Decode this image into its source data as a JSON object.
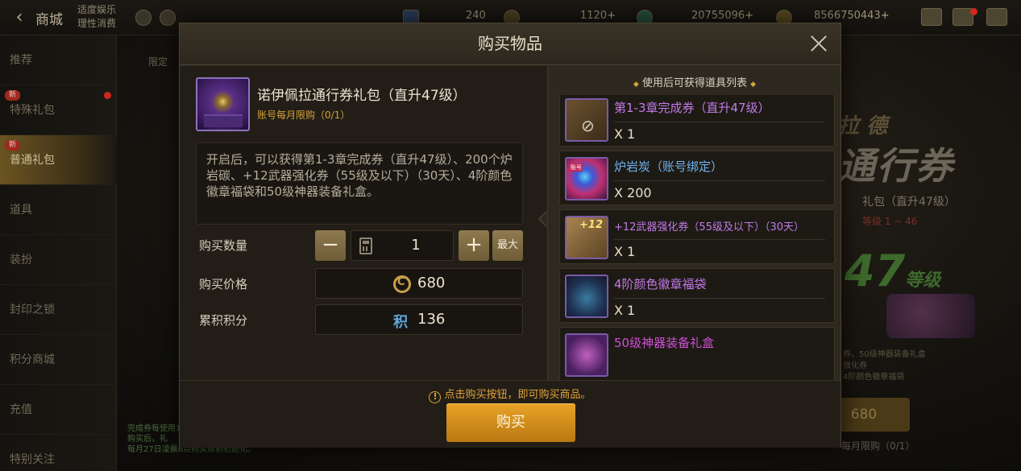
{
  "topbar": {
    "back_icon": "back-arrow-icon",
    "title": "商城",
    "notice_line1": "适度娱乐",
    "notice_line2": "理性消费",
    "currencies": [
      {
        "value": "240"
      },
      {
        "value": "1120",
        "plus": "+"
      },
      {
        "value": "20755096",
        "plus": "+"
      },
      {
        "value": "8566750443",
        "plus": "+"
      }
    ]
  },
  "sidebar": {
    "items": [
      {
        "label": "推荐"
      },
      {
        "label": "特殊礼包",
        "badge": "新"
      },
      {
        "label": "普通礼包",
        "badge": "新"
      },
      {
        "label": "道具"
      },
      {
        "label": "装扮"
      },
      {
        "label": "封印之锁"
      },
      {
        "label": "积分商城"
      },
      {
        "label": "充值"
      },
      {
        "label": "特别关注"
      }
    ],
    "tab_hint": "限定"
  },
  "banner": {
    "title_small": "拉 德",
    "title_big": "通行券",
    "subtitle": "礼包（直升47级）",
    "range_label": "等级",
    "range": "1 ~ 46",
    "level_big": "47",
    "level_suffix": "等级",
    "desc_lines": [
      "券，50级神器装备礼盒",
      "强化券",
      "4阶颜色徽章福袋"
    ],
    "buy_price": "680",
    "limit": "每月限购（0/1）"
  },
  "bottom_note": {
    "line1": "完成券每使用1张",
    "line2": "购买后，礼",
    "line3": "每月27日凌晨6点购买限制初始化。"
  },
  "modal": {
    "title": "购买物品",
    "close_icon": "close-icon",
    "item": {
      "name": "诺伊佩拉通行券礼包（直升47级）",
      "limit": "账号每月限购（0/1）",
      "description": "开启后，可以获得第1-3章完成券（直升47级）、200个炉岩碳、+12武器强化券（55级及以下）（30天）、4阶颜色徽章福袋和50级神器装备礼盒。"
    },
    "quantity": {
      "label": "购买数量",
      "minus": "−",
      "value": "1",
      "plus": "+",
      "max": "最大"
    },
    "price": {
      "label": "购买价格",
      "value": "680"
    },
    "points": {
      "label": "累积积分",
      "icon_text": "积",
      "value": "136"
    },
    "rewards_title": "使用后可获得道具列表",
    "rewards": [
      {
        "name": "第1-3章完成券（直升47级）",
        "qty": "X 1",
        "color": "#c27ae6",
        "icon": "ticket-icon"
      },
      {
        "name": "炉岩炭（账号绑定）",
        "qty": "X 200",
        "color": "#6fb2ee",
        "icon": "coal-icon"
      },
      {
        "name": "+12武器强化券（55级及以下）（30天）",
        "qty": "X 1",
        "color": "#c27ae6",
        "icon": "scroll-icon"
      },
      {
        "name": "4阶颜色徽章福袋",
        "qty": "X 1",
        "color": "#c27ae6",
        "icon": "badge-bag-icon"
      },
      {
        "name": "50级神器装备礼盒",
        "qty": "",
        "color": "#d050d8",
        "icon": "gift-box-icon"
      }
    ],
    "tip": "点击购买按钮，即可购买商品。",
    "buy_label": "购买"
  },
  "colors": {
    "accent_gold": "#d4a23a",
    "buy_button": "#e9a326",
    "epic_purple": "#c27ae6",
    "rare_blue": "#6fb2ee"
  }
}
